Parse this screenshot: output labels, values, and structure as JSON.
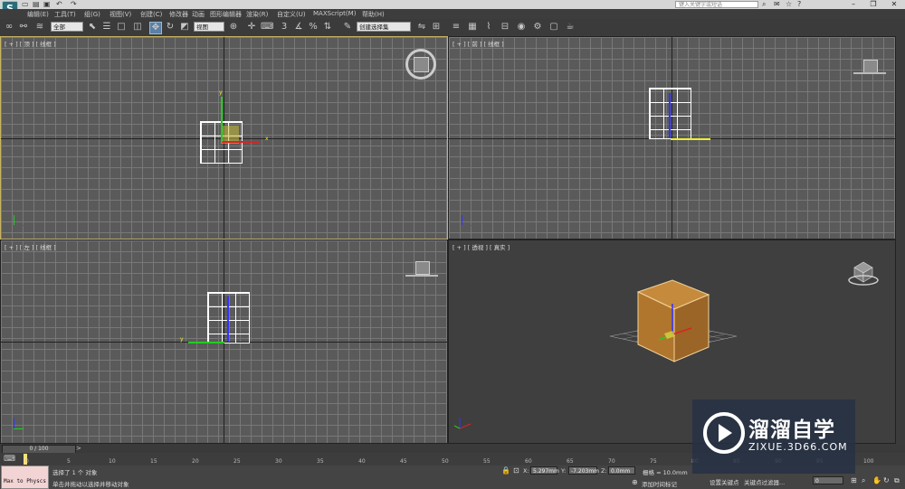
{
  "menubar": {
    "items": [
      "编辑(E)",
      "工具(T)",
      "组(G)",
      "视图(V)",
      "创建(C)",
      "修改器",
      "动画",
      "图形编辑器",
      "渲染(R)",
      "自定义(U)",
      "MAXScript(M)",
      "帮助(H)"
    ]
  },
  "titlebar": {
    "search_placeholder": "键入关键字或短语"
  },
  "toolbar": {
    "selection_filter": "全部",
    "ref_coord": "视图",
    "named_selection": "创建选择集"
  },
  "viewports": {
    "top": {
      "label": "[ + ] [ 顶 ] [ 线框 ]"
    },
    "front": {
      "label": "[ + ] [ 前 ] [ 线框 ]"
    },
    "left": {
      "label": "[ + ] [ 左 ] [ 线框 ]"
    },
    "perspective": {
      "label": "[ + ] [ 透视 ] [ 真实 ]"
    }
  },
  "timeline": {
    "slider": "0 / 100",
    "ticks": [
      "0",
      "5",
      "10",
      "15",
      "20",
      "25",
      "30",
      "35",
      "40",
      "45",
      "50",
      "55",
      "60",
      "65",
      "70",
      "75",
      "80",
      "85",
      "90",
      "95",
      "100"
    ]
  },
  "statusbar": {
    "listener": "Max to Physcs",
    "selected": "选择了 1 个 对象",
    "prompt": "单击并拖动以选择并移动对象",
    "x_label": "X:",
    "x_value": "5.297mm",
    "y_label": "Y:",
    "y_value": "-7.203mm",
    "z_label": "Z:",
    "z_value": "0.0mm",
    "grid": "栅格 = 10.0mm",
    "add_time_tag": "添加时间标记",
    "set_key": "设置关键点",
    "key_filters": "关键点过滤器...",
    "frame": "0"
  },
  "watermark": {
    "title": "溜溜自学",
    "url": "ZIXUE.3D66.COM"
  },
  "colors": {
    "viewport_bg": "#5a5a5a",
    "grid_line": "#787878",
    "active_border": "#c8b460",
    "box_color": "#b97a2f",
    "x_axis": "#dd2222",
    "y_axis": "#22cc22",
    "z_axis": "#3333ff"
  }
}
